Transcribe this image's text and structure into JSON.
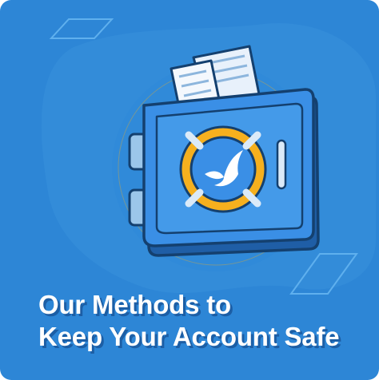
{
  "banner": {
    "headline_line_1": "Our Methods to",
    "headline_line_2": "Keep Your Account Safe",
    "logo_icon": "bird-icon",
    "colors": {
      "background": "#2d86d6",
      "safe_body": "#3a8fe6",
      "safe_outline": "#14406f",
      "ring": "#f6b01e"
    }
  }
}
